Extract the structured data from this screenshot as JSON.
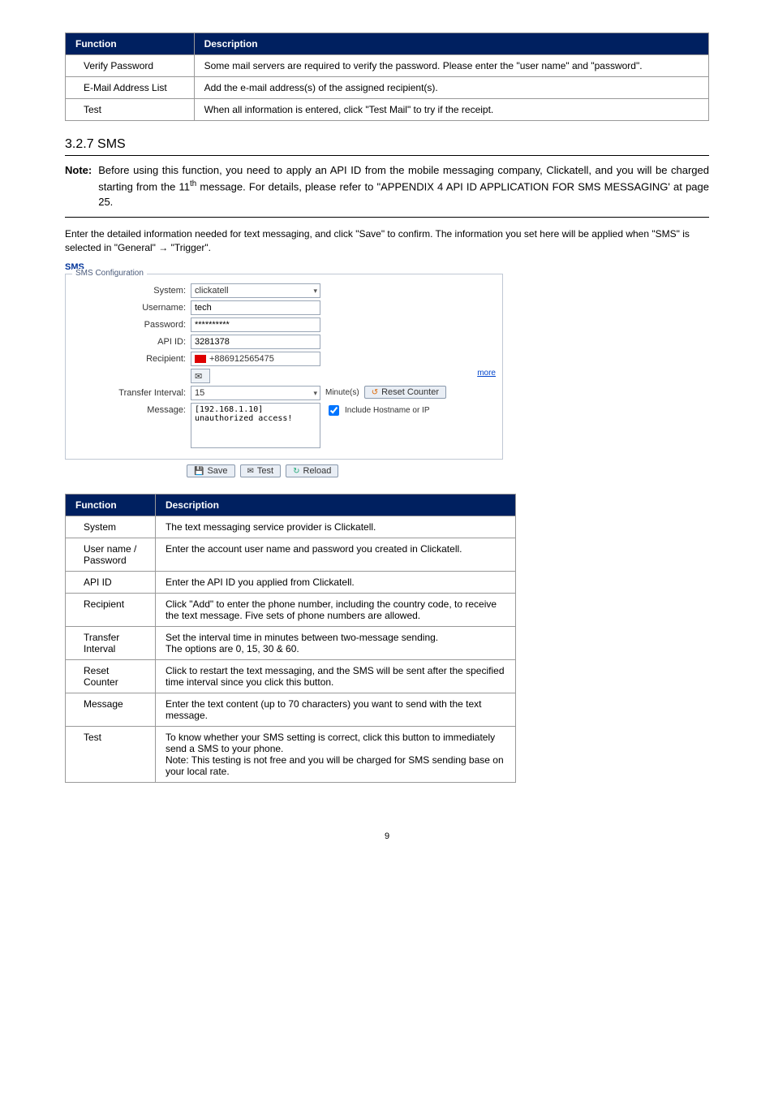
{
  "table1": {
    "headers": [
      "Function",
      "Description"
    ],
    "rows": [
      [
        "Verify Password",
        "Some mail servers are required to verify the password. Please enter the \"user name\" and \"password\"."
      ],
      [
        "E-Mail Address List",
        "Add the e-mail address(s) of the assigned recipient(s)."
      ],
      [
        "Test",
        "When all information is entered, click \"Test Mail\" to try if the receipt."
      ]
    ]
  },
  "section_heading": "3.2.7 SMS",
  "note": {
    "label": "Note:",
    "text_before_sup": "Before using this function, you need to apply an API ID from the mobile messaging company, Clickatell, and you will be charged starting from the 11",
    "sup": "th",
    "text_after_sup": " message. For details, please refer to \"APPENDIX 4 API ID APPLICATION FOR SMS MESSAGING' at page 25."
  },
  "paragraph": "Enter the detailed information needed for text messaging, and click \"Save\" to confirm. The information you set here will be applied when \"SMS\" is selected in \"General\" → \"Trigger\".",
  "sms": {
    "title": "SMS",
    "legend": "SMS Configuration",
    "labels": {
      "system": "System:",
      "username": "Username:",
      "password": "Password:",
      "apiid": "API ID:",
      "recipient": "Recipient:",
      "interval": "Transfer Interval:",
      "message": "Message:"
    },
    "values": {
      "system": "clickatell",
      "username": "tech",
      "password": "**********",
      "apiid": "3281378",
      "recipient": "+886912565475",
      "more": "more",
      "interval": "15",
      "interval_unit": "Minute(s)",
      "reset": "Reset Counter",
      "message": "[192.168.1.10] unauthorized access!",
      "include": "Include Hostname or IP"
    },
    "buttons": {
      "save": "Save",
      "test": "Test",
      "reload": "Reload"
    }
  },
  "table2": {
    "headers": [
      "Function",
      "Description"
    ],
    "rows": [
      {
        "f": "System",
        "d": "The text messaging service provider is Clickatell."
      },
      {
        "f": "User name / Password",
        "d": "Enter the account user name and password you created in Clickatell."
      },
      {
        "f": "API ID",
        "d": "Enter the API ID you applied from Clickatell."
      },
      {
        "f": "Recipient",
        "d": "Click \"Add\" to enter the phone number, including the country code, to receive the text message. Five sets of phone numbers are allowed."
      },
      {
        "f": "Transfer Interval",
        "d": "Set the interval time in minutes between two-message sending.\nThe options are 0, 15, 30 & 60."
      },
      {
        "f": "Reset Counter",
        "d": "Click to restart the text messaging, and the SMS will be sent after the specified time interval since you click this button."
      },
      {
        "f": "Message",
        "d": "Enter the text content (up to 70 characters) you want to send with the text message."
      },
      {
        "f": "Test",
        "d": "To know whether your SMS setting is correct, click this button to immediately send a SMS to your phone.\nNote: This testing is not free and you will be charged for SMS sending base on your local rate."
      }
    ]
  },
  "page_number": "9"
}
